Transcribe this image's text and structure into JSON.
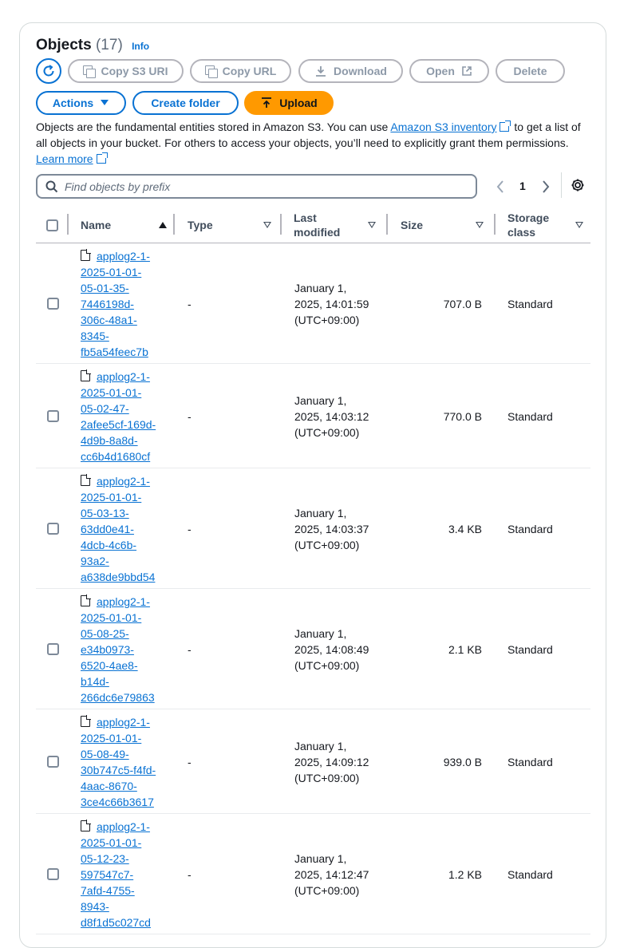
{
  "header": {
    "title": "Objects",
    "count": "(17)",
    "info": "Info"
  },
  "toolbar": {
    "copy_s3_uri": "Copy S3 URI",
    "copy_url": "Copy URL",
    "download": "Download",
    "open": "Open",
    "delete": "Delete",
    "actions": "Actions",
    "create_folder": "Create folder",
    "upload": "Upload"
  },
  "description": {
    "part1": "Objects are the fundamental entities stored in Amazon S3. You can use ",
    "link1": "Amazon S3 inventory",
    "part2": " to get a list of all objects in your bucket. For others to access your objects, you’ll need to explicitly grant them permissions. ",
    "link2": "Learn more"
  },
  "search": {
    "placeholder": "Find objects by prefix"
  },
  "pagination": {
    "current_page": "1",
    "prev": "‹",
    "next": "›"
  },
  "columns": {
    "name": "Name",
    "type": "Type",
    "last_modified": "Last modified",
    "size": "Size",
    "storage_class": "Storage class"
  },
  "rows": [
    {
      "name_lines": [
        "applog2-1-",
        "2025-01-01-",
        "05-01-35-",
        "7446198d-",
        "306c-48a1-",
        "8345-",
        "fb5a54feec7b"
      ],
      "type": "-",
      "modified_lines": [
        "January 1,",
        "2025, 14:01:59",
        "(UTC+09:00)"
      ],
      "size": "707.0 B",
      "storage_class": "Standard"
    },
    {
      "name_lines": [
        "applog2-1-",
        "2025-01-01-",
        "05-02-47-",
        "2afee5cf-169d-",
        "4d9b-8a8d-",
        "cc6b4d1680cf"
      ],
      "type": "-",
      "modified_lines": [
        "January 1,",
        "2025, 14:03:12",
        "(UTC+09:00)"
      ],
      "size": "770.0 B",
      "storage_class": "Standard"
    },
    {
      "name_lines": [
        "applog2-1-",
        "2025-01-01-",
        "05-03-13-",
        "63dd0e41-",
        "4dcb-4c6b-",
        "93a2-",
        "a638de9bbd54"
      ],
      "type": "-",
      "modified_lines": [
        "January 1,",
        "2025, 14:03:37",
        "(UTC+09:00)"
      ],
      "size": "3.4 KB",
      "storage_class": "Standard"
    },
    {
      "name_lines": [
        "applog2-1-",
        "2025-01-01-",
        "05-08-25-",
        "e34b0973-",
        "6520-4ae8-",
        "b14d-",
        "266dc6e79863"
      ],
      "type": "-",
      "modified_lines": [
        "January 1,",
        "2025, 14:08:49",
        "(UTC+09:00)"
      ],
      "size": "2.1 KB",
      "storage_class": "Standard"
    },
    {
      "name_lines": [
        "applog2-1-",
        "2025-01-01-",
        "05-08-49-",
        "30b747c5-f4fd-",
        "4aac-8670-",
        "3ce4c66b3617"
      ],
      "type": "-",
      "modified_lines": [
        "January 1,",
        "2025, 14:09:12",
        "(UTC+09:00)"
      ],
      "size": "939.0 B",
      "storage_class": "Standard"
    },
    {
      "name_lines": [
        "applog2-1-",
        "2025-01-01-",
        "05-12-23-",
        "597547c7-",
        "7afd-4755-",
        "8943-",
        "d8f1d5c027cd"
      ],
      "type": "-",
      "modified_lines": [
        "January 1,",
        "2025, 14:12:47",
        "(UTC+09:00)"
      ],
      "size": "1.2 KB",
      "storage_class": "Standard"
    }
  ]
}
